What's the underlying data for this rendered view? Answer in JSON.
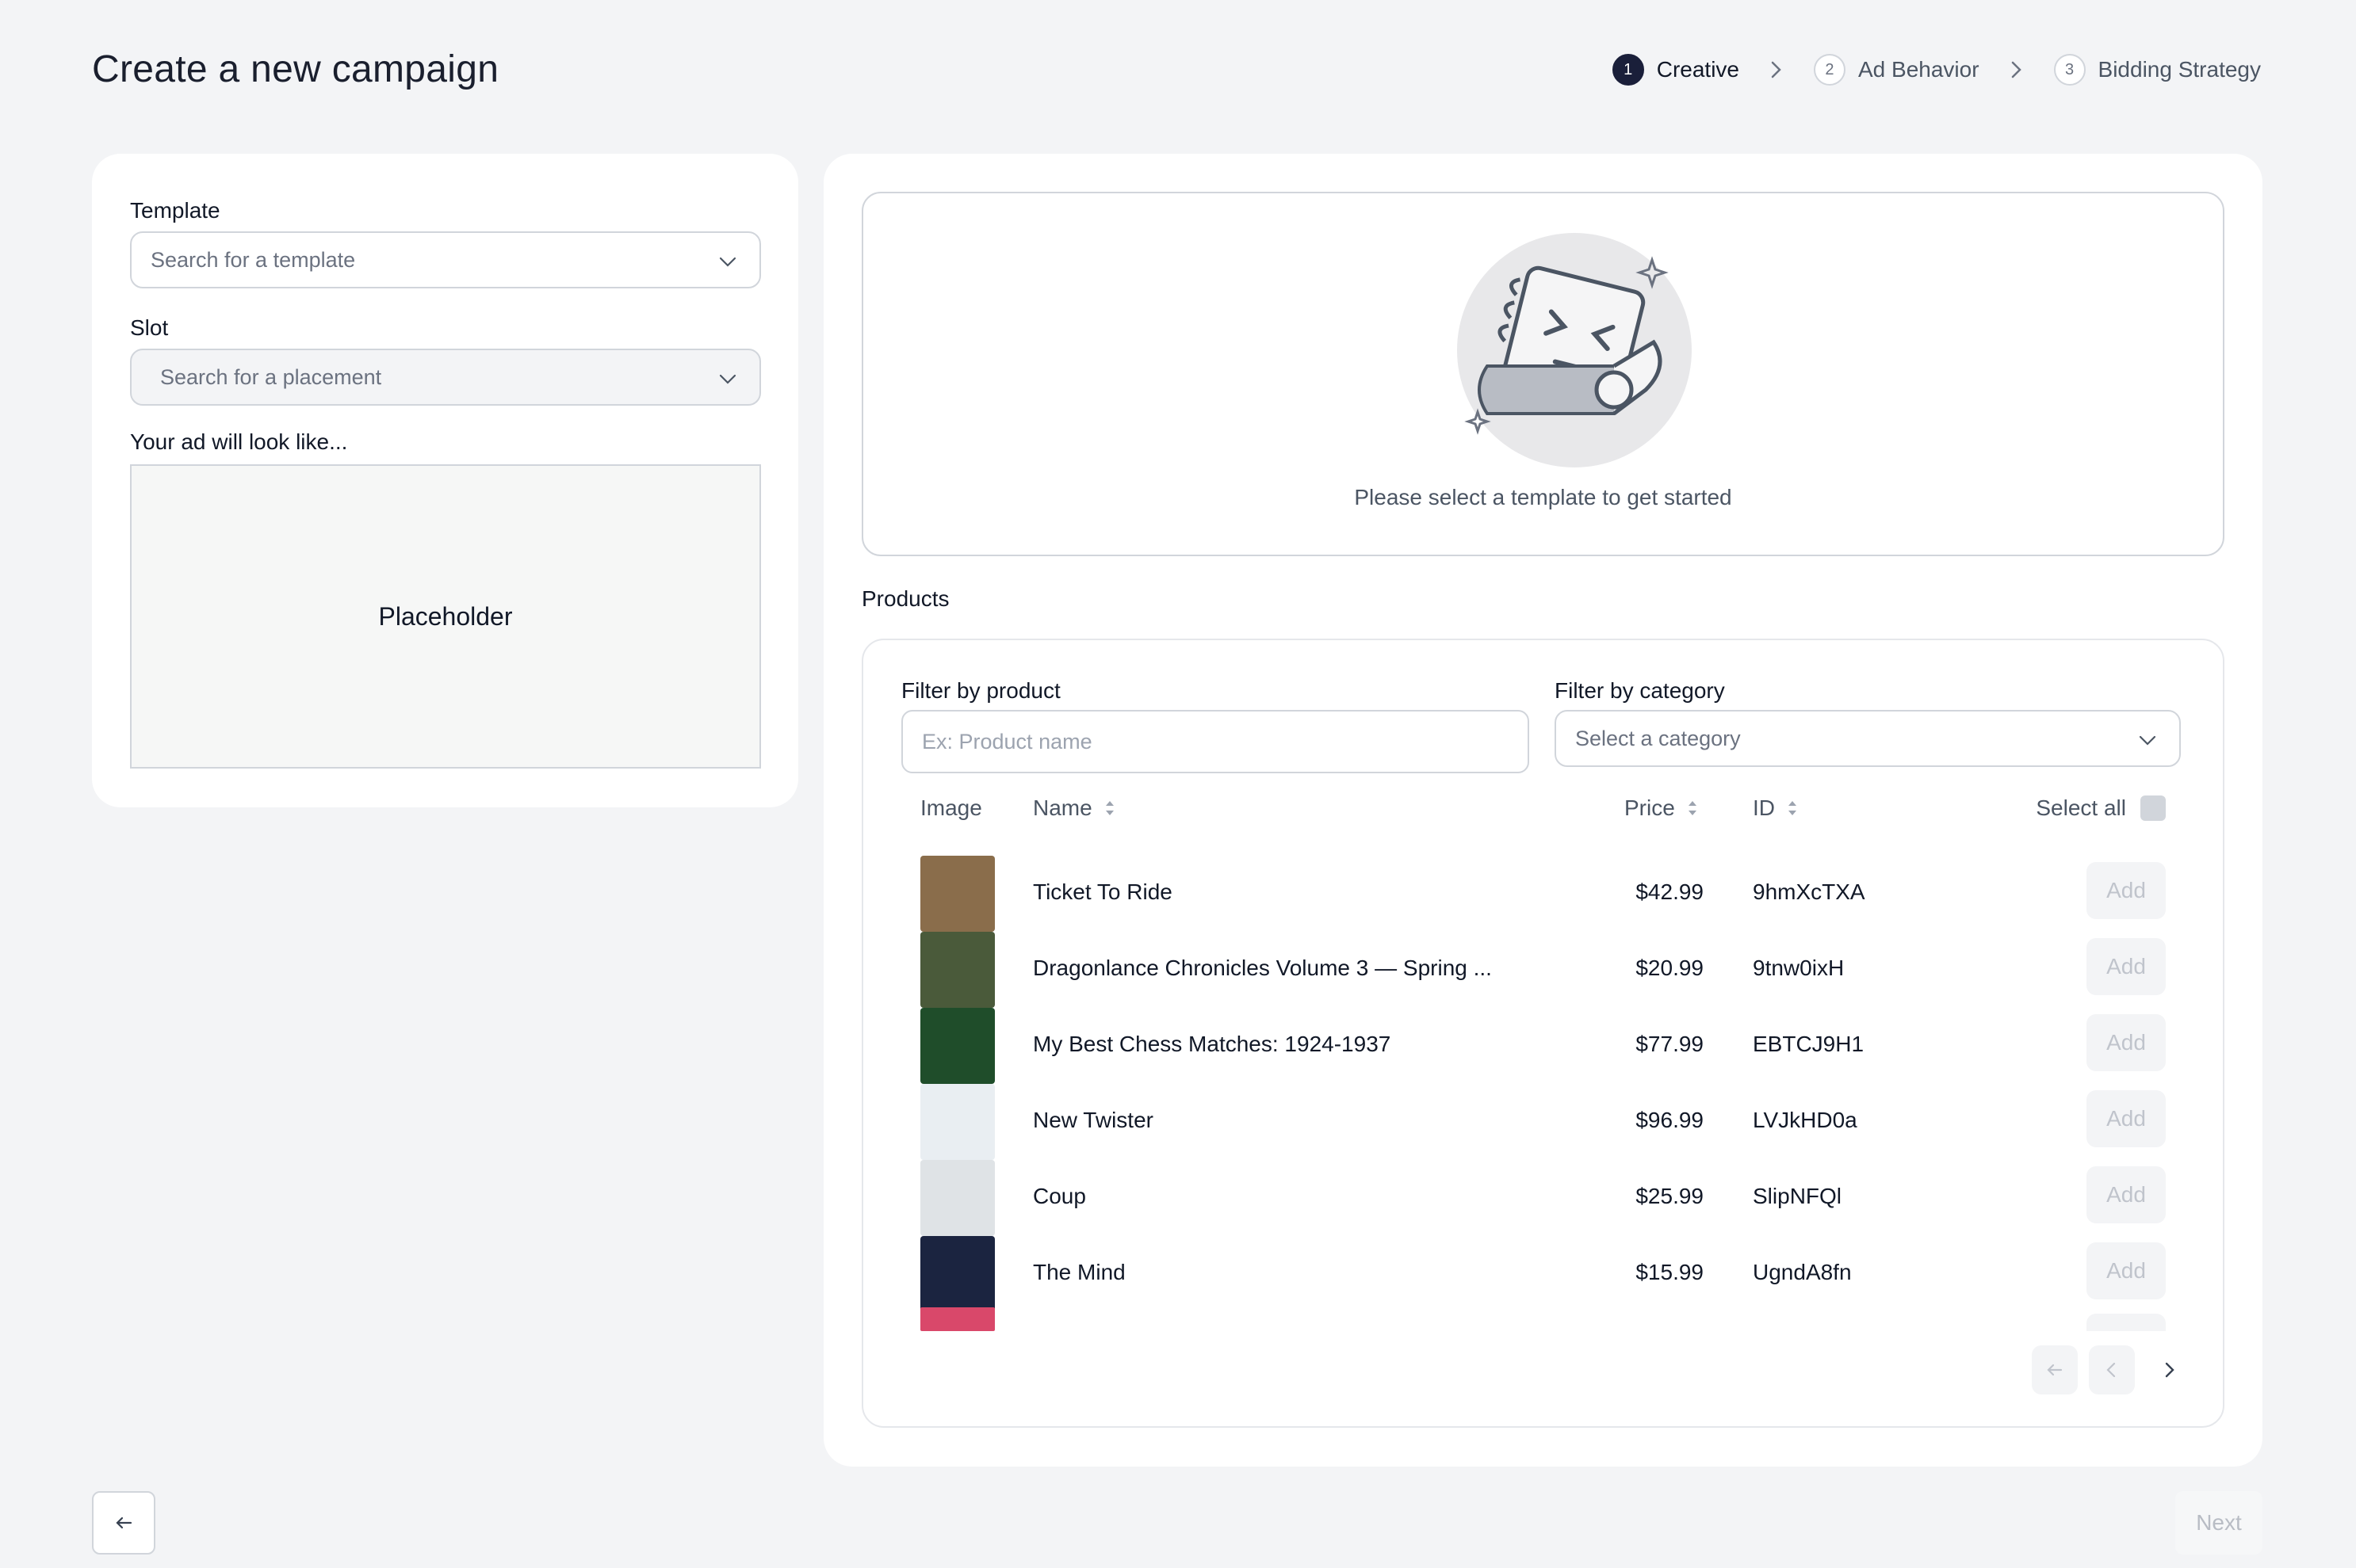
{
  "page": {
    "title": "Create a new campaign"
  },
  "stepper": [
    {
      "num": "1",
      "label": "Creative",
      "active": true
    },
    {
      "num": "2",
      "label": "Ad Behavior",
      "active": false
    },
    {
      "num": "3",
      "label": "Bidding Strategy",
      "active": false
    }
  ],
  "left": {
    "template_label": "Template",
    "template_placeholder": "Search for a template",
    "slot_label": "Slot",
    "slot_placeholder": "Search for a placement",
    "preview_label": "Your ad will look like...",
    "preview_text": "Placeholder"
  },
  "right": {
    "empty_text": "Please select a template to get started",
    "products_label": "Products",
    "filter_product_label": "Filter by product",
    "filter_product_placeholder": "Ex: Product name",
    "filter_category_label": "Filter by category",
    "filter_category_placeholder": "Select a category",
    "columns": {
      "image": "Image",
      "name": "Name",
      "price": "Price",
      "id": "ID",
      "select_all": "Select all"
    },
    "add_label": "Add",
    "products": [
      {
        "name": "Ticket To Ride",
        "price": "$42.99",
        "id": "9hmXcTXA",
        "color": "#8a6d4b"
      },
      {
        "name": "Dragonlance Chronicles Volume 3 — Spring ...",
        "price": "$20.99",
        "id": "9tnw0ixH",
        "color": "#4a5a3a"
      },
      {
        "name": "My Best Chess Matches: 1924-1937",
        "price": "$77.99",
        "id": "EBTCJ9H1",
        "color": "#1f4d2a"
      },
      {
        "name": "New Twister",
        "price": "$96.99",
        "id": "LVJkHD0a",
        "color": "#e9eef2"
      },
      {
        "name": "Coup",
        "price": "$25.99",
        "id": "SlipNFQl",
        "color": "#dfe3e6"
      },
      {
        "name": "The Mind",
        "price": "$15.99",
        "id": "UgndA8fn",
        "color": "#1b2440"
      }
    ]
  },
  "footer": {
    "next_label": "Next"
  }
}
